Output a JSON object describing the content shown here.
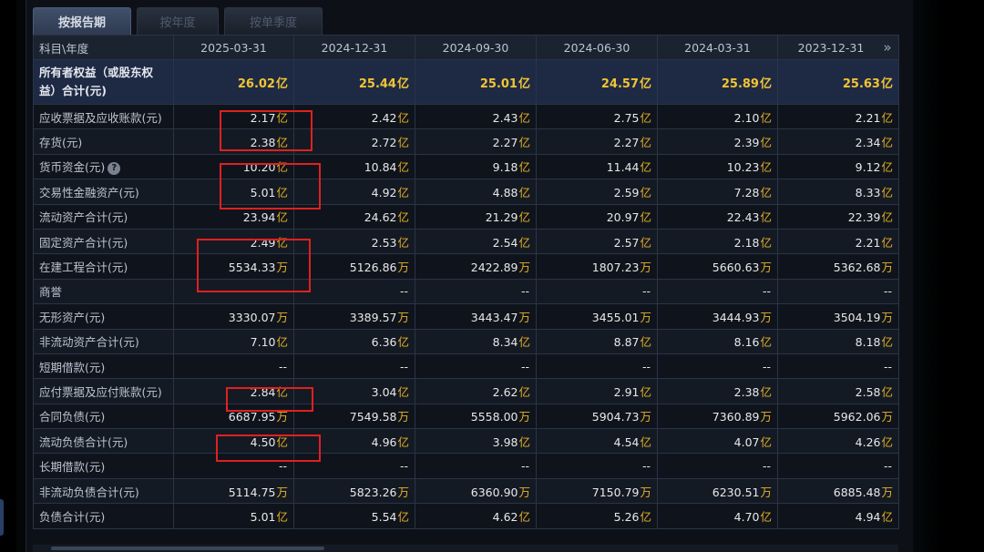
{
  "tabs": [
    {
      "label": "按报告期",
      "active": true
    },
    {
      "label": "按年度",
      "active": false
    },
    {
      "label": "按单季度",
      "active": false
    }
  ],
  "table": {
    "corner_header": "科目\\年度",
    "columns": [
      "2025-03-31",
      "2024-12-31",
      "2024-09-30",
      "2024-06-30",
      "2024-03-31",
      "2023-12-31"
    ],
    "equity_row": {
      "label": "所有者权益（或股东权益）合计(元)",
      "values": [
        {
          "num": "26.02",
          "unit": "亿"
        },
        {
          "num": "25.44",
          "unit": "亿"
        },
        {
          "num": "25.01",
          "unit": "亿"
        },
        {
          "num": "24.57",
          "unit": "亿"
        },
        {
          "num": "25.89",
          "unit": "亿"
        },
        {
          "num": "25.63",
          "unit": "亿"
        }
      ]
    },
    "rows": [
      {
        "label": "应收票据及应收账款(元)",
        "values": [
          [
            "2.17",
            "亿"
          ],
          [
            "2.42",
            "亿"
          ],
          [
            "2.43",
            "亿"
          ],
          [
            "2.75",
            "亿"
          ],
          [
            "2.10",
            "亿"
          ],
          [
            "2.21",
            "亿"
          ]
        ]
      },
      {
        "label": "存货(元)",
        "values": [
          [
            "2.38",
            "亿"
          ],
          [
            "2.72",
            "亿"
          ],
          [
            "2.27",
            "亿"
          ],
          [
            "2.27",
            "亿"
          ],
          [
            "2.39",
            "亿"
          ],
          [
            "2.34",
            "亿"
          ]
        ]
      },
      {
        "label": "货币资金(元)",
        "help": true,
        "help_glyph": "?",
        "values": [
          [
            "10.20",
            "亿"
          ],
          [
            "10.84",
            "亿"
          ],
          [
            "9.18",
            "亿"
          ],
          [
            "11.44",
            "亿"
          ],
          [
            "10.23",
            "亿"
          ],
          [
            "9.12",
            "亿"
          ]
        ]
      },
      {
        "label": "交易性金融资产(元)",
        "values": [
          [
            "5.01",
            "亿"
          ],
          [
            "4.92",
            "亿"
          ],
          [
            "4.88",
            "亿"
          ],
          [
            "2.59",
            "亿"
          ],
          [
            "7.28",
            "亿"
          ],
          [
            "8.33",
            "亿"
          ]
        ]
      },
      {
        "label": "流动资产合计(元)",
        "values": [
          [
            "23.94",
            "亿"
          ],
          [
            "24.62",
            "亿"
          ],
          [
            "21.29",
            "亿"
          ],
          [
            "20.97",
            "亿"
          ],
          [
            "22.43",
            "亿"
          ],
          [
            "22.39",
            "亿"
          ]
        ]
      },
      {
        "label": "固定资产合计(元)",
        "values": [
          [
            "2.49",
            "亿"
          ],
          [
            "2.53",
            "亿"
          ],
          [
            "2.54",
            "亿"
          ],
          [
            "2.57",
            "亿"
          ],
          [
            "2.18",
            "亿"
          ],
          [
            "2.21",
            "亿"
          ]
        ]
      },
      {
        "label": "在建工程合计(元)",
        "values": [
          [
            "5534.33",
            "万"
          ],
          [
            "5126.86",
            "万"
          ],
          [
            "2422.89",
            "万"
          ],
          [
            "1807.23",
            "万"
          ],
          [
            "5660.63",
            "万"
          ],
          [
            "5362.68",
            "万"
          ]
        ]
      },
      {
        "label": "商誉",
        "values": [
          [
            "--",
            ""
          ],
          [
            "--",
            ""
          ],
          [
            "--",
            ""
          ],
          [
            "--",
            ""
          ],
          [
            "--",
            ""
          ],
          [
            "--",
            ""
          ]
        ]
      },
      {
        "label": "无形资产(元)",
        "values": [
          [
            "3330.07",
            "万"
          ],
          [
            "3389.57",
            "万"
          ],
          [
            "3443.47",
            "万"
          ],
          [
            "3455.01",
            "万"
          ],
          [
            "3444.93",
            "万"
          ],
          [
            "3504.19",
            "万"
          ]
        ]
      },
      {
        "label": "非流动资产合计(元)",
        "values": [
          [
            "7.10",
            "亿"
          ],
          [
            "6.36",
            "亿"
          ],
          [
            "8.34",
            "亿"
          ],
          [
            "8.87",
            "亿"
          ],
          [
            "8.16",
            "亿"
          ],
          [
            "8.18",
            "亿"
          ]
        ]
      },
      {
        "label": "短期借款(元)",
        "values": [
          [
            "--",
            ""
          ],
          [
            "--",
            ""
          ],
          [
            "--",
            ""
          ],
          [
            "--",
            ""
          ],
          [
            "--",
            ""
          ],
          [
            "--",
            ""
          ]
        ]
      },
      {
        "label": "应付票据及应付账款(元)",
        "values": [
          [
            "2.84",
            "亿"
          ],
          [
            "3.04",
            "亿"
          ],
          [
            "2.62",
            "亿"
          ],
          [
            "2.91",
            "亿"
          ],
          [
            "2.38",
            "亿"
          ],
          [
            "2.58",
            "亿"
          ]
        ]
      },
      {
        "label": "合同负债(元)",
        "values": [
          [
            "6687.95",
            "万"
          ],
          [
            "7549.58",
            "万"
          ],
          [
            "5558.00",
            "万"
          ],
          [
            "5904.73",
            "万"
          ],
          [
            "7360.89",
            "万"
          ],
          [
            "5962.06",
            "万"
          ]
        ]
      },
      {
        "label": "流动负债合计(元)",
        "values": [
          [
            "4.50",
            "亿"
          ],
          [
            "4.96",
            "亿"
          ],
          [
            "3.98",
            "亿"
          ],
          [
            "4.54",
            "亿"
          ],
          [
            "4.07",
            "亿"
          ],
          [
            "4.26",
            "亿"
          ]
        ]
      },
      {
        "label": "长期借款(元)",
        "values": [
          [
            "--",
            ""
          ],
          [
            "--",
            ""
          ],
          [
            "--",
            ""
          ],
          [
            "--",
            ""
          ],
          [
            "--",
            ""
          ],
          [
            "--",
            ""
          ]
        ]
      },
      {
        "label": "非流动负债合计(元)",
        "values": [
          [
            "5114.75",
            "万"
          ],
          [
            "5823.26",
            "万"
          ],
          [
            "6360.90",
            "万"
          ],
          [
            "7150.79",
            "万"
          ],
          [
            "6230.51",
            "万"
          ],
          [
            "6885.48",
            "万"
          ]
        ]
      },
      {
        "label": "负债合计(元)",
        "values": [
          [
            "5.01",
            "亿"
          ],
          [
            "5.54",
            "亿"
          ],
          [
            "4.62",
            "亿"
          ],
          [
            "5.26",
            "亿"
          ],
          [
            "4.70",
            "亿"
          ],
          [
            "4.94",
            "亿"
          ]
        ]
      }
    ]
  },
  "more_icon": "»",
  "colors": {
    "value_unit": "#e9b224",
    "equity_value": "#f3c433",
    "highlight_box": "#e02020",
    "header_bg": "#1b2230",
    "equity_bg": "#1e2a44"
  },
  "icons": [
    "double-chevron-right-icon",
    "question-mark-icon"
  ]
}
